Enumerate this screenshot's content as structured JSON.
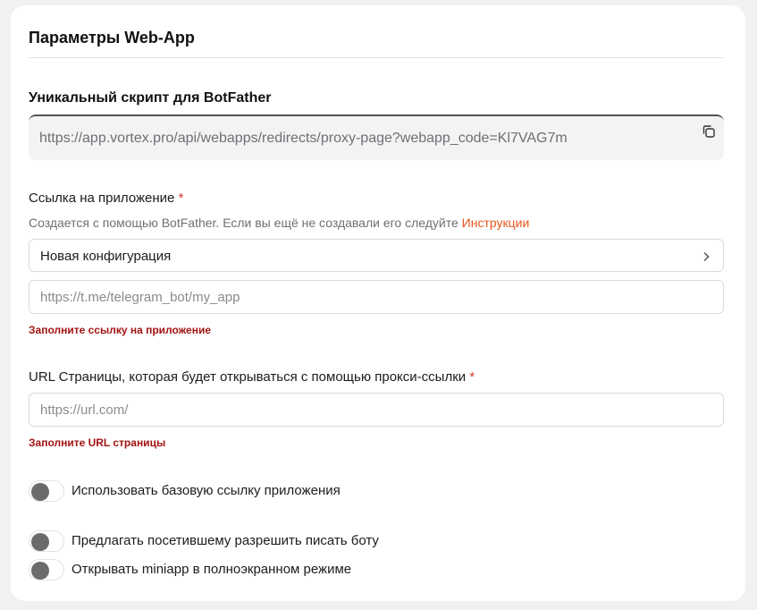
{
  "card": {
    "title": "Параметры Web-App"
  },
  "script_section": {
    "title": "Уникальный скрипт для BotFather",
    "url": "https://app.vortex.pro/api/webapps/redirects/proxy-page?webapp_code=Kl7VAG7m",
    "copy_icon": "copy-icon"
  },
  "app_link": {
    "label": "Ссылка на приложение",
    "required_mark": "*",
    "hint": "Создается с помощью BotFather. Если вы ещё не создавали его следуйте",
    "hint_link": "Инструкции",
    "select_value": "Новая конфигурация",
    "chevron_icon": "chevron-right-icon",
    "input_placeholder": "https://t.me/telegram_bot/my_app",
    "input_value": "",
    "error": "Заполните ссылку на приложение"
  },
  "page_url": {
    "label": "URL Страницы, которая будет открываться с помощью прокси-ссылки",
    "required_mark": "*",
    "input_placeholder": "https://url.com/",
    "input_value": "",
    "error": "Заполните URL страницы"
  },
  "toggles": [
    {
      "label": "Использовать базовую ссылку приложения",
      "on": false
    },
    {
      "label": "Предлагать посетившему разрешить писать боту",
      "on": false
    },
    {
      "label": "Открывать miniapp в полноэкранном режиме",
      "on": false
    }
  ],
  "colors": {
    "accent_link": "#e8561e",
    "required": "#d93a2b",
    "error": "#a21313",
    "toggle_knob": "#6b6b6b"
  }
}
